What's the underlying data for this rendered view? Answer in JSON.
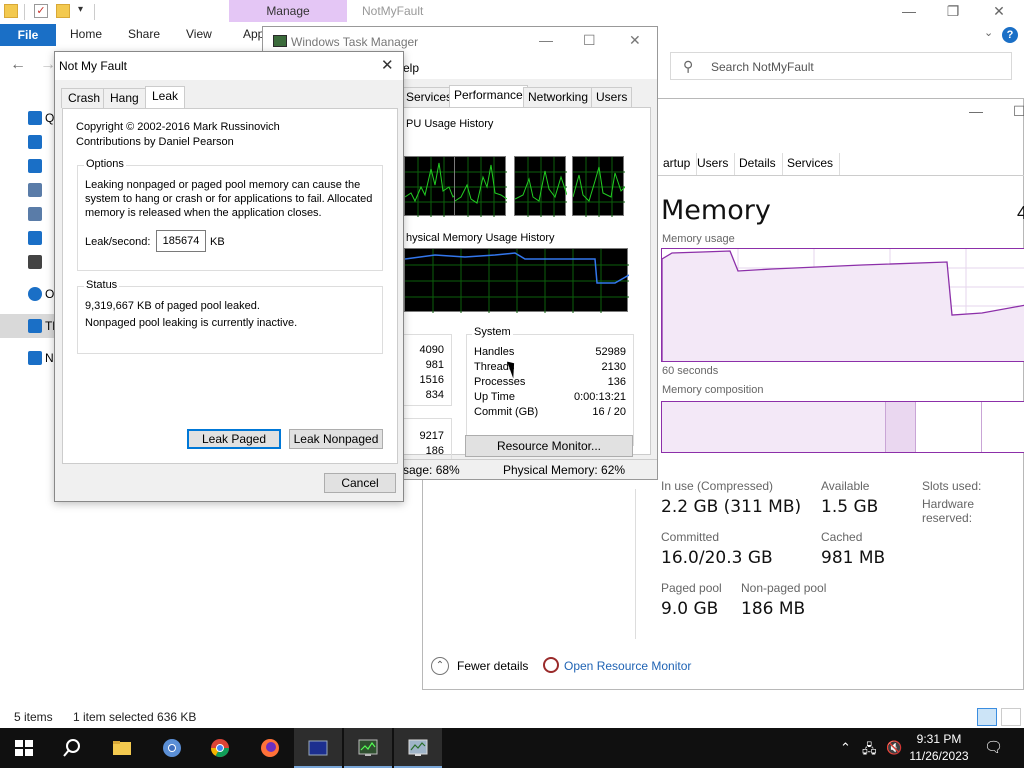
{
  "explorer": {
    "manage_tab": "Manage",
    "title": "NotMyFault",
    "ribbon": {
      "file": "File",
      "home": "Home",
      "share": "Share",
      "view": "View",
      "app": "App"
    },
    "search_placeholder": "Search NotMyFault",
    "nav": [
      {
        "label": "Q",
        "icon": "star-icon",
        "color": "#1a6fc6"
      },
      {
        "label": "",
        "icon": "desktop-icon",
        "color": "#1a6fc6"
      },
      {
        "label": "",
        "icon": "download-icon",
        "color": "#1a6fc6"
      },
      {
        "label": "",
        "icon": "document-icon",
        "color": "#5a7ca8"
      },
      {
        "label": "",
        "icon": "pictures-icon",
        "color": "#5a7ca8"
      },
      {
        "label": "",
        "icon": "music-icon",
        "color": "#1a6fc6"
      },
      {
        "label": "",
        "icon": "video-icon",
        "color": "#444444"
      },
      {
        "label": "O",
        "icon": "onedrive-icon",
        "color": "#1a6fc6"
      },
      {
        "label": "Th",
        "icon": "this-pc-icon",
        "color": "#1a6fc6"
      },
      {
        "label": "N",
        "icon": "network-icon",
        "color": "#1a6fc6"
      }
    ],
    "status": {
      "items": "5 items",
      "selected": "1 item selected  636 KB"
    }
  },
  "tm_new": {
    "tabs": [
      "artup",
      "Users",
      "Details",
      "Services"
    ],
    "heading": "Memory",
    "heading_suffix": "4",
    "usage_label": "Memory usage",
    "seconds_label": "60 seconds",
    "composition_label": "Memory composition",
    "stats": {
      "in_use_label": "In use (Compressed)",
      "in_use": "2.2 GB (311 MB)",
      "available_label": "Available",
      "available": "1.5 GB",
      "slots_label": "Slots used:",
      "hw_label": "Hardware reserved:",
      "committed_label": "Committed",
      "committed": "16.0/20.3 GB",
      "cached_label": "Cached",
      "cached": "981 MB",
      "paged_label": "Paged pool",
      "paged": "9.0 GB",
      "nonpaged_label": "Non-paged pool",
      "nonpaged": "186 MB"
    },
    "fewer_details": "Fewer details",
    "open_rm": "Open Resource Monitor",
    "accent": "#8c2fa9"
  },
  "tm_old": {
    "title": "Windows Task Manager",
    "menu_help": "elp",
    "tabs": [
      "Services",
      "Performance",
      "Networking",
      "Users"
    ],
    "cpu_history": "PU Usage History",
    "mem_history": "hysical Memory Usage History",
    "left_values": [
      "4090",
      "981",
      "1516",
      "834"
    ],
    "left_values2": [
      "9217",
      "186"
    ],
    "system_label": "System",
    "system": [
      {
        "name": "Handles",
        "value": "52989"
      },
      {
        "name": "Threads",
        "value": "2130"
      },
      {
        "name": "Processes",
        "value": "136"
      },
      {
        "name": "Up Time",
        "value": "0:00:13:21"
      },
      {
        "name": "Commit (GB)",
        "value": "16 / 20"
      }
    ],
    "resource_monitor": "Resource Monitor...",
    "status_cpu": "sage: 68%",
    "status_mem": "Physical Memory: 62%",
    "graph_green": "#22cc22",
    "graph_blue": "#3377ee"
  },
  "nmf": {
    "title": "Not My Fault",
    "tabs": [
      "Crash",
      "Hang",
      "Leak"
    ],
    "copyright": "Copyright © 2002-2016 Mark Russinovich",
    "contributions": "Contributions by Daniel Pearson",
    "options_label": "Options",
    "options_text": "Leaking nonpaged or paged pool memory can cause the system to hang or crash or for applications to fail. Allocated memory is released when the application closes.",
    "leak_label": "Leak/second:",
    "leak_value": "185674",
    "leak_unit": "KB",
    "status_label": "Status",
    "status_line1": "9,319,667 KB of paged pool leaked.",
    "status_line2": "Nonpaged pool leaking is currently inactive.",
    "btn_paged": "Leak Paged",
    "btn_nonpaged": "Leak Nonpaged",
    "btn_cancel": "Cancel"
  },
  "taskbar": {
    "time": "9:31 PM",
    "date": "11/26/2023"
  }
}
